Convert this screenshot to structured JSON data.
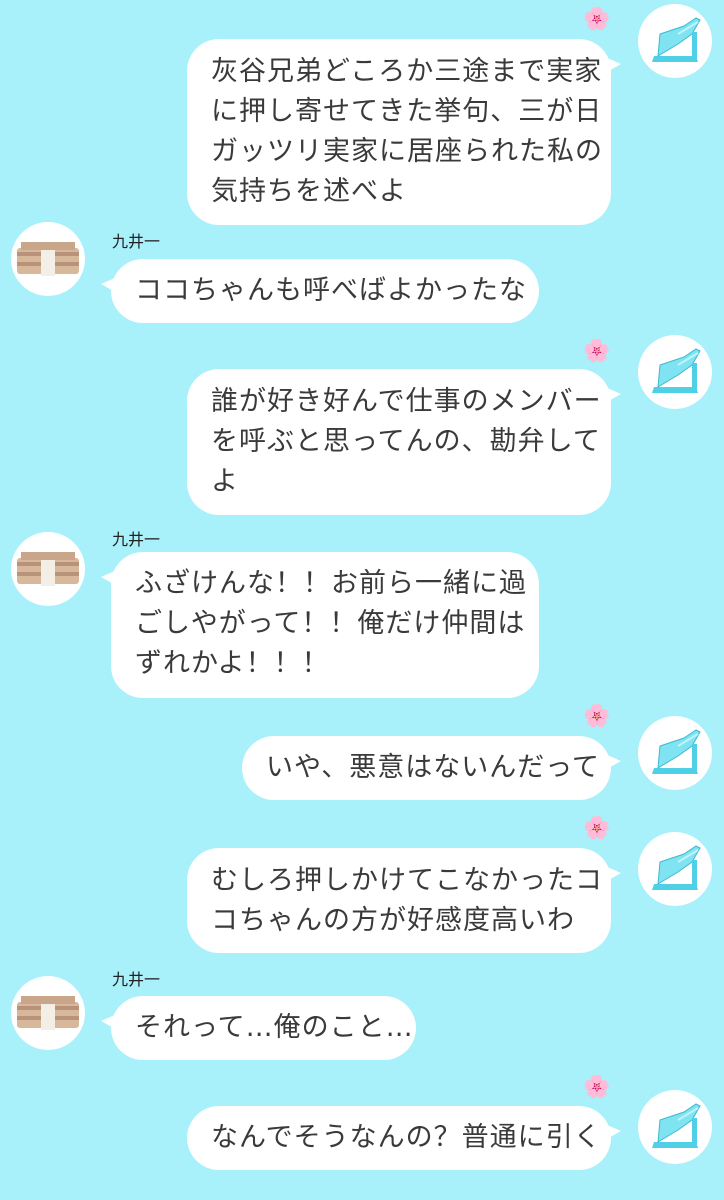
{
  "colors": {
    "background": "#a8f0fa",
    "bubble": "#ffffff",
    "text": "#3a3a3a",
    "heel": "#4fd0e6"
  },
  "icons": {
    "flower": "🌸",
    "me_avatar": "high-heel-shoe-icon",
    "other_avatar": "money-stack-icon"
  },
  "messages": [
    {
      "sender": "me",
      "lines": [
        "灰谷兄弟どころか三途まで実家",
        "に押し寄せてきた挙句、三が日",
        "ガッツリ実家に居座られた私の",
        "気持ちを述べよ"
      ]
    },
    {
      "sender": "other",
      "name": "九井一",
      "lines": [
        "ココちゃんも呼べばよかったな"
      ]
    },
    {
      "sender": "me",
      "lines": [
        "誰が好き好んで仕事のメンバー",
        "を呼ぶと思ってんの、勘弁して",
        "よ"
      ]
    },
    {
      "sender": "other",
      "name": "九井一",
      "lines": [
        "ふざけんな！！お前ら一緒に過",
        "ごしやがって！！俺だけ仲間は",
        "ずれかよ！！！"
      ]
    },
    {
      "sender": "me",
      "lines": [
        "いや、悪意はないんだって"
      ]
    },
    {
      "sender": "me",
      "lines": [
        "むしろ押しかけてこなかったコ",
        "コちゃんの方が好感度高いわ"
      ]
    },
    {
      "sender": "other",
      "name": "九井一",
      "lines": [
        "それって…俺のこと…"
      ]
    },
    {
      "sender": "me",
      "lines": [
        "なんでそうなんの？普通に引く"
      ]
    }
  ]
}
